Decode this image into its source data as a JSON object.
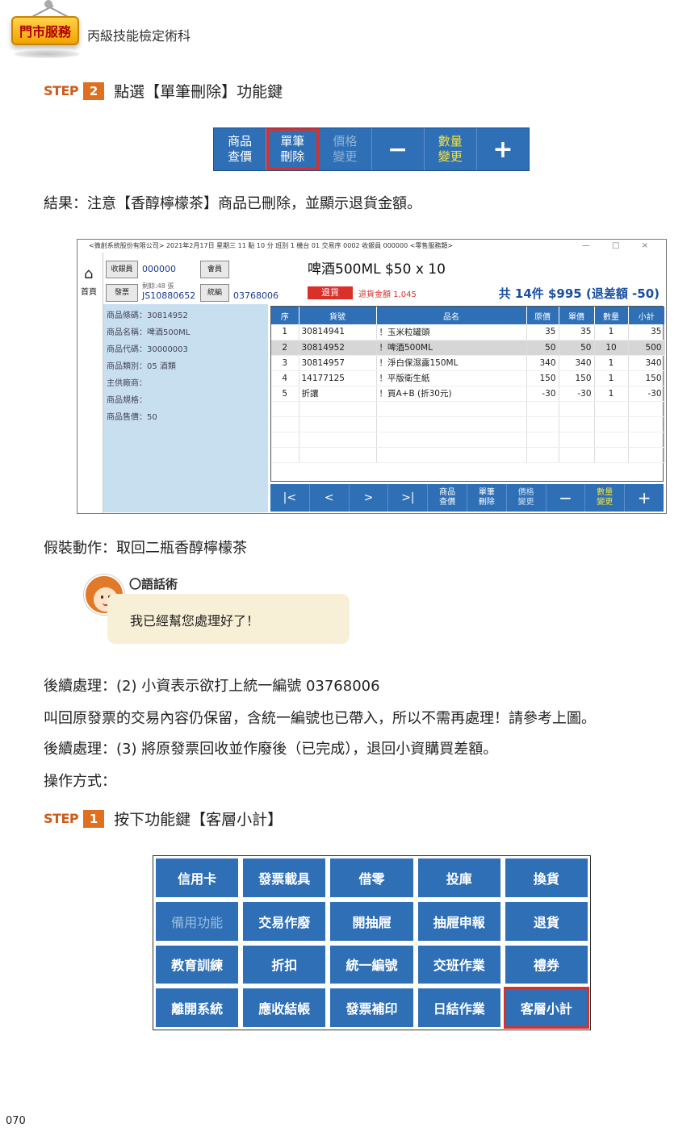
{
  "header": {
    "badge": "門市服務",
    "subtitle": "丙級技能檢定術科"
  },
  "step2": {
    "label": "STEP",
    "number": "2",
    "text": "點選【單筆刪除】功能鍵"
  },
  "toolbar_small": [
    {
      "line1": "商品",
      "line2": "查價"
    },
    {
      "line1": "單筆",
      "line2": "刪除"
    },
    {
      "line1": "價格",
      "line2": "變更"
    },
    {
      "line1": "−",
      "line2": ""
    },
    {
      "line1": "數量",
      "line2": "變更"
    },
    {
      "line1": "+",
      "line2": ""
    }
  ],
  "result_text": "結果：注意【香醇檸檬茶】商品已刪除，並顯示退貨金額。",
  "pos": {
    "title": "<微創系統股份有限公司> 2021年2月17日 星期三 11 點 10 分 班別 1 機台 01 交易序 0002 收銀員 000000 <零售服務類>",
    "window_controls": "— □ ×",
    "home_label": "首頁",
    "cashier_btn": "收銀員",
    "cashier_no": "000000",
    "member_btn": "會員",
    "invoice_btn": "發票",
    "invoice_remain": "剩餘:48 張",
    "invoice_no": "JS10880652",
    "tax_btn": "統編",
    "tax_no": "03768006",
    "product_line": "啤酒500ML    $50 x 10",
    "return_btn": "退貨",
    "return_amount": "退貨金額 1,045",
    "total": "共 14件 $995 (退差額 -50)",
    "info": [
      "商品條碼：30814952",
      "商品名稱：啤酒500ML",
      "商品代碼：30000003",
      "商品類別：05 酒類",
      "主供廠商：",
      "商品規格：",
      "商品售價：50"
    ],
    "columns": [
      "序",
      "貨號",
      "品名",
      "原價",
      "單價",
      "數量",
      "小計"
    ],
    "rows": [
      [
        "1",
        "30814941",
        "！玉米粒罐頭",
        "35",
        "35",
        "1",
        "35"
      ],
      [
        "2",
        "30814952",
        "！啤酒500ML",
        "50",
        "50",
        "10",
        "500"
      ],
      [
        "3",
        "30814957",
        "！淨白保濕露150ML",
        "340",
        "340",
        "1",
        "340"
      ],
      [
        "4",
        "14177125",
        "！平版衛生紙",
        "150",
        "150",
        "1",
        "150"
      ],
      [
        "5",
        "折讓",
        "！買A+B (折30元)",
        "-30",
        "-30",
        "1",
        "-30"
      ]
    ],
    "bottom_bar": [
      {
        "l1": "|<",
        "l2": ""
      },
      {
        "l1": "<",
        "l2": ""
      },
      {
        "l1": ">",
        "l2": ""
      },
      {
        "l1": ">|",
        "l2": ""
      },
      {
        "l1": "商品",
        "l2": "查價"
      },
      {
        "l1": "單筆",
        "l2": "刪除"
      },
      {
        "l1": "價格",
        "l2": "變更"
      },
      {
        "l1": "−",
        "l2": ""
      },
      {
        "l1": "數量",
        "l2": "變更"
      },
      {
        "l1": "+",
        "l2": ""
      }
    ]
  },
  "fake_action": "假裝動作：取回二瓶香醇檸檬茶",
  "talk": {
    "title": "〇語話術",
    "text": "我已經幫您處理好了！"
  },
  "followup": [
    "後續處理：(2) 小資表示欲打上統一編號 03768006",
    "叫回原發票的交易內容仍保留，含統一編號也已帶入，所以不需再處理！請參考上圖。",
    "後續處理：(3) 將原發票回收並作廢後（已完成），退回小資購買差額。",
    "操作方式："
  ],
  "step1": {
    "label": "STEP",
    "number": "1",
    "text": "按下功能鍵【客層小計】"
  },
  "keypad": [
    "信用卡",
    "發票載具",
    "借零",
    "投庫",
    "換貨",
    "備用功能",
    "交易作廢",
    "開抽屜",
    "抽屜申報",
    "退貨",
    "教育訓練",
    "折扣",
    "統一編號",
    "交班作業",
    "禮券",
    "離開系統",
    "應收結帳",
    "發票補印",
    "日結作業",
    "客層小計"
  ],
  "page_number": "070"
}
